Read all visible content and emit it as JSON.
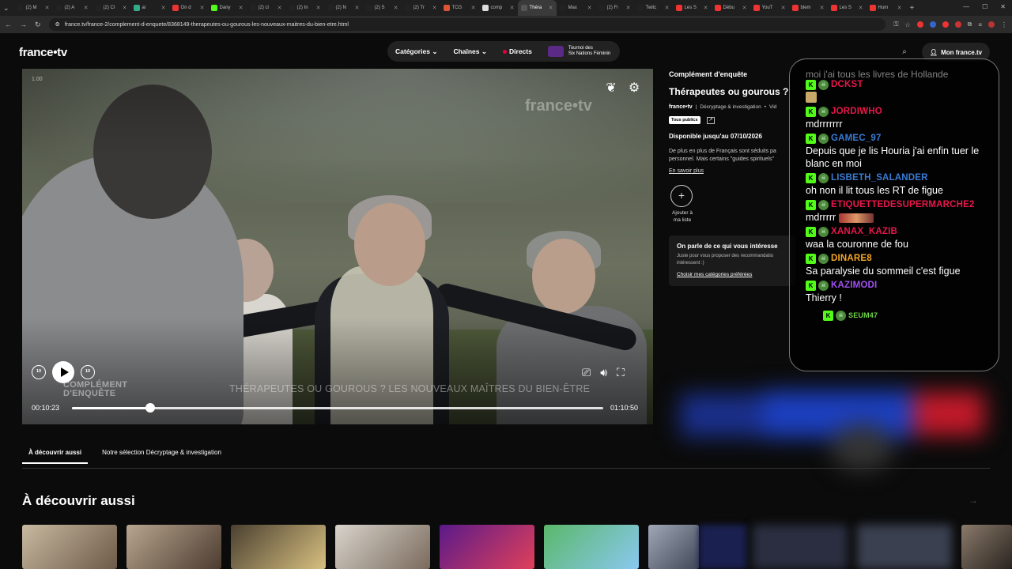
{
  "browser": {
    "tabs": [
      {
        "label": "(2) M",
        "color": "#222"
      },
      {
        "label": "(2) A",
        "color": "#222"
      },
      {
        "label": "(2) Cl",
        "color": "#222"
      },
      {
        "label": "ai",
        "color": "#3a8"
      },
      {
        "label": "On d",
        "color": "#e33"
      },
      {
        "label": "Dany",
        "color": "#53fc18"
      },
      {
        "label": "(2) cl",
        "color": "#222"
      },
      {
        "label": "(2) In",
        "color": "#222"
      },
      {
        "label": "(2) N",
        "color": "#222"
      },
      {
        "label": "(2) S",
        "color": "#222"
      },
      {
        "label": "(2) Tr",
        "color": "#222"
      },
      {
        "label": "TCG",
        "color": "#d53"
      },
      {
        "label": "comp",
        "color": "#ddd"
      },
      {
        "label": "Théra",
        "color": "#555"
      },
      {
        "label": "Max",
        "color": "#222"
      },
      {
        "label": "(2) Fi",
        "color": "#222"
      },
      {
        "label": "Twitc",
        "color": "#222"
      },
      {
        "label": "Les S",
        "color": "#e33"
      },
      {
        "label": "Débu",
        "color": "#e33"
      },
      {
        "label": "YouT",
        "color": "#e33"
      },
      {
        "label": "blem",
        "color": "#e33"
      },
      {
        "label": "Les S",
        "color": "#e33"
      },
      {
        "label": "Hum",
        "color": "#e33"
      }
    ],
    "active_tab_index": 13,
    "url": "france.tv/france-2/complement-d-enquete/8368149-therapeutes-ou-gourous-les-nouveaux-maitres-du-bien-etre.html"
  },
  "header": {
    "logo": "france•tv",
    "nav": {
      "categories": "Catégories",
      "channels": "Chaînes",
      "live": "Directs",
      "tournoi_line1": "Tournoi des",
      "tournoi_line2": "Six Nations Féminin"
    },
    "account": "Mon france.tv"
  },
  "player": {
    "corner_value": "1.00",
    "watermark": "france•tv",
    "show_logo_line1": "COMPLÉMENT",
    "show_logo_line2": "D'ENQUÊTE",
    "subtitle": "THÉRAPEUTES OU GOUROUS ? LES NOUVEAUX MAÎTRES DU BIEN-ÊTRE",
    "skip_back": "10",
    "skip_fwd": "10",
    "current_time": "00:10:23",
    "duration": "01:10:50",
    "progress": 0.147
  },
  "info": {
    "show": "Complément d'enquête",
    "title": "Thérapeutes ou gourous ?",
    "channel": "france•tv",
    "genre": "Décryptage & investigation",
    "extra": "Vid",
    "rating": "Tous publics",
    "available": "Disponible jusqu'au 07/10/2026",
    "desc_line1": "De plus en plus de Français sont séduits pa",
    "desc_line2": "personnel. Mais certains \"guides spirituels\"",
    "more": "En savoir plus",
    "add_line1": "Ajouter à",
    "add_line2": "ma liste",
    "reco_title": "On parle de ce qui vous intéresse",
    "reco_sub1": "Juste pour vous proposer des recommandatio",
    "reco_sub2": "intéressent :)",
    "reco_link": "Choisir mes catégories préférées"
  },
  "chat": {
    "top_ghost": "moi j'ai tous les livres de Hollande",
    "messages": [
      {
        "user": "DCKST",
        "color": "#e8174a",
        "text": "",
        "ghost": ""
      },
      {
        "user": "JORDIWHO",
        "color": "#e8174a",
        "text": "mdrrrrrrr",
        "ghost": ""
      },
      {
        "user": "GAMEC_97",
        "color": "#3a7bd5",
        "text": "Depuis que je lis Houria j'ai enfin tuer le blanc en moi",
        "ghost": ""
      },
      {
        "user": "LISBETH_SALANDER",
        "color": "#3a7bd5",
        "text": "oh non il lit tous les RT de figue",
        "ghost": ""
      },
      {
        "user": "ETIQUETTEDESUPERMARCHE2",
        "color": "#e8174a",
        "text": "mdrrrrr",
        "ghost": ""
      },
      {
        "user": "XANAX_KAZIB",
        "color": "#e8174a",
        "text": "waa la couronne de fou",
        "ghost": ""
      },
      {
        "user": "DINARE8",
        "color": "#f5a623",
        "text": "Sa paralysie du sommeil c'est figue",
        "ghost": ""
      },
      {
        "user": "KAZIMODI",
        "color": "#a050f0",
        "text": "Thierry !",
        "ghost": ""
      }
    ],
    "last_user": "SEUM47"
  },
  "below": {
    "tab_active": "À découvrir aussi",
    "tab_other": "Notre sélection Décryptage & investigation",
    "rail_title": "À découvrir aussi",
    "rail_next": "→"
  },
  "colors": {
    "accent": "#e8003d",
    "kick_green": "#53fc18"
  }
}
